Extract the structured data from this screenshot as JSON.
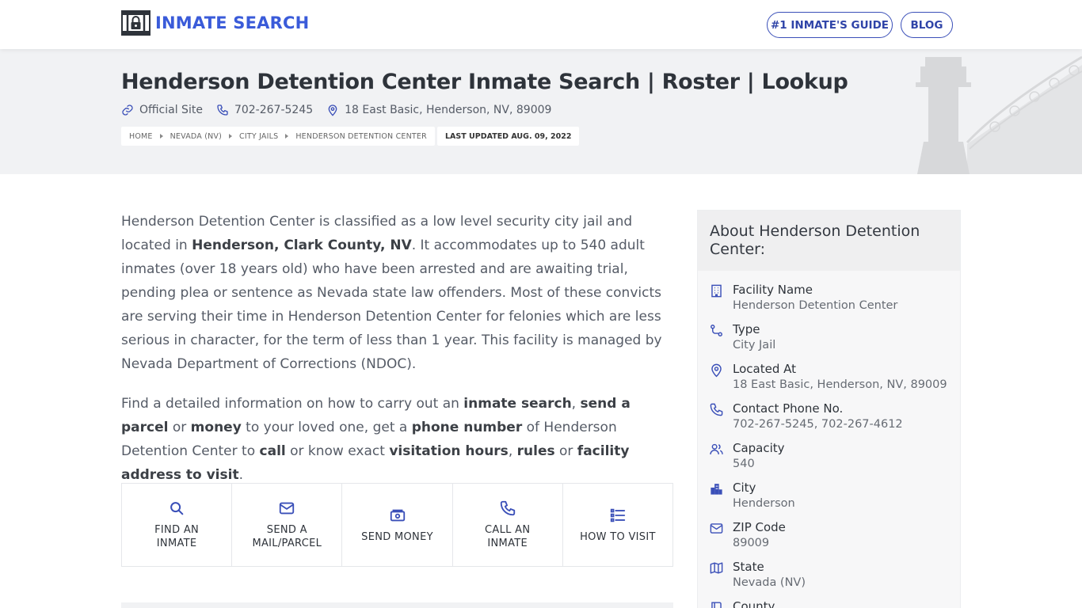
{
  "header": {
    "logo_text": "INMATE SEARCH",
    "nav": [
      {
        "label": "#1 INMATE'S GUIDE"
      },
      {
        "label": "BLOG"
      }
    ]
  },
  "hero": {
    "title": "Henderson Detention Center Inmate Search | Roster | Lookup",
    "official_site": "Official Site",
    "phone": "702-267-5245",
    "address": "18 East Basic, Henderson, NV, 89009",
    "breadcrumbs": [
      "HOME",
      "NEVADA (NV)",
      "CITY JAILS",
      "HENDERSON DETENTION CENTER"
    ],
    "updated": "LAST UPDATED AUG. 09, 2022"
  },
  "intro": {
    "p1_a": "Henderson Detention Center is classified as a low level security city jail and located in ",
    "p1_b": "Henderson, Clark County, NV",
    "p1_c": ". It accommodates up to 540 adult inmates (over 18 years old) who have been arrested and are awaiting trial, pending plea or sentence as Nevada state law offenders. Most of these convicts are serving their time in Henderson Detention Center for felonies which are less serious in character, for the term of less than 1 year. This facility is managed by Nevada Department of Corrections (NDOC).",
    "p2": [
      {
        "t": "Find a detailed information on how to carry out an "
      },
      {
        "t": "inmate search",
        "b": true
      },
      {
        "t": ", "
      },
      {
        "t": "send a parcel",
        "b": true
      },
      {
        "t": " or "
      },
      {
        "t": "money",
        "b": true
      },
      {
        "t": " to your loved one, get a "
      },
      {
        "t": "phone number",
        "b": true
      },
      {
        "t": " of Henderson Detention Center to "
      },
      {
        "t": "call",
        "b": true
      },
      {
        "t": " or know exact "
      },
      {
        "t": "visitation hours",
        "b": true
      },
      {
        "t": ", "
      },
      {
        "t": "rules",
        "b": true
      },
      {
        "t": " or "
      },
      {
        "t": "facility address to visit",
        "b": true
      },
      {
        "t": "."
      }
    ]
  },
  "actions": [
    {
      "line1": "FIND AN",
      "line2": "INMATE",
      "icon": "search-icon"
    },
    {
      "line1": "SEND A",
      "line2": "MAIL/PARCEL",
      "icon": "mail-icon"
    },
    {
      "line1": "SEND MONEY",
      "line2": "",
      "icon": "money-icon"
    },
    {
      "line1": "CALL AN",
      "line2": "INMATE",
      "icon": "phone-icon"
    },
    {
      "line1": "HOW TO VISIT",
      "line2": "",
      "icon": "list-icon"
    }
  ],
  "sidebar": {
    "title": "About Henderson Detention Center:",
    "facts": [
      {
        "label": "Facility Name",
        "value": "Henderson Detention Center",
        "icon": "building-icon"
      },
      {
        "label": "Type",
        "value": "City Jail",
        "icon": "route-icon"
      },
      {
        "label": "Located At",
        "value": "18 East Basic, Henderson, NV, 89009",
        "icon": "map-pin-icon"
      },
      {
        "label": "Contact Phone No.",
        "value": "702-267-5245, 702-267-4612",
        "icon": "phone-icon"
      },
      {
        "label": "Capacity",
        "value": "540",
        "icon": "users-icon"
      },
      {
        "label": "City",
        "value": "Henderson",
        "icon": "city-icon"
      },
      {
        "label": "ZIP Code",
        "value": "89009",
        "icon": "mail-icon"
      },
      {
        "label": "State",
        "value": "Nevada (NV)",
        "icon": "map-icon"
      },
      {
        "label": "County",
        "value": "",
        "icon": "book-icon"
      }
    ]
  },
  "colors": {
    "brand": "#3a5bd9",
    "text": "#555b66",
    "heading": "#2e333a"
  }
}
